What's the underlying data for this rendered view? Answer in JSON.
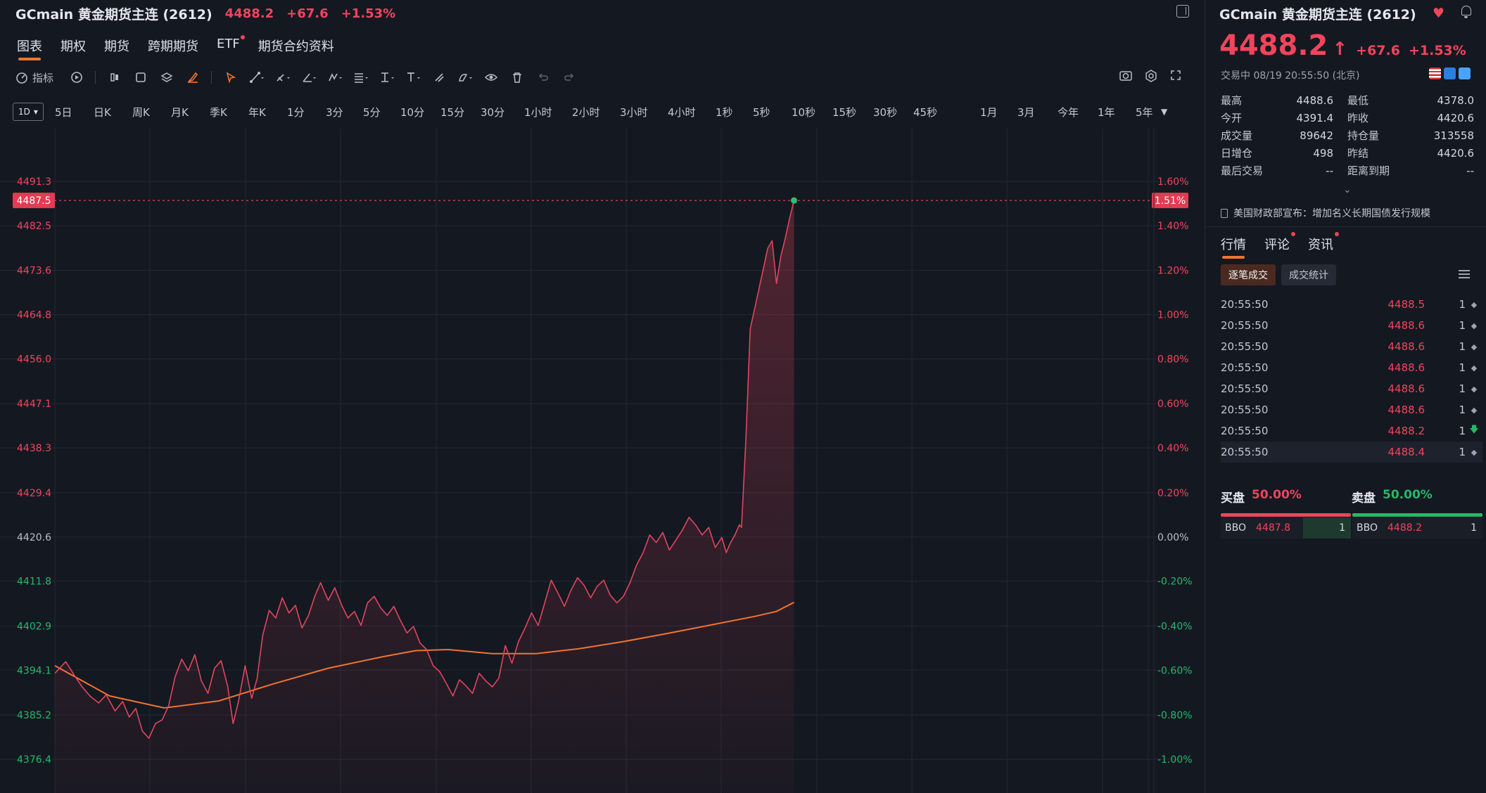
{
  "header": {
    "symbol": "GCmain",
    "name": "黄金期货主连 (2612)",
    "price": "4488.2",
    "change": "+67.6",
    "change_pct": "+1.53%"
  },
  "nav": {
    "tabs": [
      "图表",
      "期权",
      "期货",
      "跨期期货",
      "ETF",
      "期货合约资料"
    ],
    "active": "图表"
  },
  "toolbar": {
    "indicator_label": "指标",
    "icons": [
      "indicator-icon",
      "replay-icon",
      "candle-icon",
      "rect-icon",
      "layers-icon",
      "brush-icon",
      "cursor-icon",
      "trendline-icon",
      "pen-icon",
      "angle-icon",
      "pattern-icon",
      "fib-icon",
      "measure-icon",
      "text-icon",
      "magnet-icon",
      "shape-icon",
      "eye-icon",
      "trash-icon",
      "undo-icon",
      "redo-icon"
    ],
    "right_icons": [
      "camera-icon",
      "gear-icon",
      "fullscreen-icon"
    ]
  },
  "periods": {
    "selected": "1D",
    "items": [
      "5日",
      "日K",
      "周K",
      "月K",
      "季K",
      "年K",
      "1分",
      "3分",
      "5分",
      "10分",
      "15分",
      "30分",
      "1小时",
      "2小时",
      "3小时",
      "4小时",
      "1秒",
      "5秒",
      "10秒",
      "15秒",
      "30秒",
      "45秒",
      "1月",
      "3月",
      "今年",
      "1年",
      "5年"
    ]
  },
  "colors": {
    "up": "#f0455c",
    "down": "#25b86a",
    "accent": "#f0742e",
    "avg_line": "#f0742e",
    "background": "#141821"
  },
  "chart_data": {
    "type": "line",
    "prev_close": 4420.6,
    "y_ticks": [
      "4491.3",
      "4482.5",
      "4473.6",
      "4464.8",
      "4456.0",
      "4447.1",
      "4438.3",
      "4429.4",
      "4420.6",
      "4411.8",
      "4402.9",
      "4394.1",
      "4385.2",
      "4376.4"
    ],
    "y_tick_values": [
      4491.3,
      4482.5,
      4473.6,
      4464.8,
      4456.0,
      4447.1,
      4438.3,
      4429.4,
      4420.6,
      4411.8,
      4402.9,
      4394.1,
      4385.2,
      4376.4
    ],
    "pct_ticks": [
      "1.60%",
      "1.40%",
      "1.20%",
      "1.00%",
      "0.80%",
      "0.60%",
      "0.40%",
      "0.20%",
      "0.00%",
      "-0.20%",
      "-0.40%",
      "-0.60%",
      "-0.80%",
      "-1.00%"
    ],
    "current_price_label": "4487.5",
    "current_pct_label": "1.51%",
    "current_value": 4487.5,
    "ylim": [
      4374.5,
      4495.0
    ],
    "session_fraction": 0.628,
    "price_series": [
      [
        0.0,
        4393.5
      ],
      [
        0.01,
        4395.8
      ],
      [
        0.018,
        4393.0
      ],
      [
        0.025,
        4390.8
      ],
      [
        0.032,
        4389.0
      ],
      [
        0.04,
        4387.6
      ],
      [
        0.047,
        4389.2
      ],
      [
        0.055,
        4386.0
      ],
      [
        0.062,
        4387.9
      ],
      [
        0.068,
        4384.8
      ],
      [
        0.074,
        4386.5
      ],
      [
        0.08,
        4382.0
      ],
      [
        0.086,
        4380.6
      ],
      [
        0.092,
        4383.5
      ],
      [
        0.098,
        4384.2
      ],
      [
        0.104,
        4387.0
      ],
      [
        0.11,
        4392.8
      ],
      [
        0.116,
        4396.3
      ],
      [
        0.122,
        4394.0
      ],
      [
        0.128,
        4397.2
      ],
      [
        0.134,
        4392.0
      ],
      [
        0.14,
        4389.5
      ],
      [
        0.146,
        4394.5
      ],
      [
        0.152,
        4396.0
      ],
      [
        0.158,
        4391.0
      ],
      [
        0.163,
        4383.5
      ],
      [
        0.168,
        4388.0
      ],
      [
        0.174,
        4395.0
      ],
      [
        0.18,
        4388.5
      ],
      [
        0.185,
        4392.5
      ],
      [
        0.19,
        4401.0
      ],
      [
        0.196,
        4406.0
      ],
      [
        0.202,
        4404.5
      ],
      [
        0.208,
        4408.5
      ],
      [
        0.214,
        4405.5
      ],
      [
        0.22,
        4407.0
      ],
      [
        0.226,
        4402.5
      ],
      [
        0.232,
        4405.0
      ],
      [
        0.238,
        4409.0
      ],
      [
        0.243,
        4411.5
      ],
      [
        0.25,
        4408.0
      ],
      [
        0.256,
        4410.5
      ],
      [
        0.262,
        4407.2
      ],
      [
        0.268,
        4404.5
      ],
      [
        0.274,
        4405.8
      ],
      [
        0.28,
        4403.0
      ],
      [
        0.286,
        4407.5
      ],
      [
        0.292,
        4408.8
      ],
      [
        0.298,
        4406.5
      ],
      [
        0.304,
        4405.0
      ],
      [
        0.31,
        4406.8
      ],
      [
        0.316,
        4404.0
      ],
      [
        0.322,
        4401.5
      ],
      [
        0.328,
        4402.8
      ],
      [
        0.334,
        4399.5
      ],
      [
        0.34,
        4398.2
      ],
      [
        0.346,
        4395.0
      ],
      [
        0.352,
        4393.8
      ],
      [
        0.358,
        4391.5
      ],
      [
        0.364,
        4389.0
      ],
      [
        0.37,
        4392.2
      ],
      [
        0.376,
        4391.0
      ],
      [
        0.382,
        4389.5
      ],
      [
        0.388,
        4393.5
      ],
      [
        0.394,
        4392.0
      ],
      [
        0.4,
        4390.8
      ],
      [
        0.406,
        4392.5
      ],
      [
        0.412,
        4399.0
      ],
      [
        0.418,
        4395.5
      ],
      [
        0.424,
        4399.8
      ],
      [
        0.43,
        4402.5
      ],
      [
        0.436,
        4405.5
      ],
      [
        0.442,
        4403.0
      ],
      [
        0.448,
        4407.5
      ],
      [
        0.454,
        4412.0
      ],
      [
        0.46,
        4409.5
      ],
      [
        0.466,
        4406.8
      ],
      [
        0.472,
        4410.0
      ],
      [
        0.478,
        4412.5
      ],
      [
        0.484,
        4411.0
      ],
      [
        0.49,
        4408.5
      ],
      [
        0.496,
        4410.8
      ],
      [
        0.502,
        4412.0
      ],
      [
        0.508,
        4409.0
      ],
      [
        0.514,
        4407.5
      ],
      [
        0.52,
        4408.8
      ],
      [
        0.526,
        4411.5
      ],
      [
        0.532,
        4415.0
      ],
      [
        0.538,
        4417.5
      ],
      [
        0.544,
        4421.0
      ],
      [
        0.55,
        4419.5
      ],
      [
        0.556,
        4421.5
      ],
      [
        0.562,
        4418.0
      ],
      [
        0.568,
        4420.0
      ],
      [
        0.574,
        4422.0
      ],
      [
        0.58,
        4424.5
      ],
      [
        0.586,
        4423.0
      ],
      [
        0.592,
        4421.0
      ],
      [
        0.598,
        4422.5
      ],
      [
        0.604,
        4418.5
      ],
      [
        0.61,
        4420.5
      ],
      [
        0.614,
        4417.5
      ],
      [
        0.618,
        4419.5
      ],
      [
        0.622,
        4421.0
      ],
      [
        0.626,
        4423.0
      ],
      [
        0.628,
        4422.5
      ],
      [
        0.632,
        4440.0
      ],
      [
        0.636,
        4462.0
      ],
      [
        0.64,
        4466.0
      ],
      [
        0.644,
        4470.0
      ],
      [
        0.648,
        4474.0
      ],
      [
        0.652,
        4478.0
      ],
      [
        0.656,
        4479.5
      ],
      [
        0.66,
        4471.0
      ],
      [
        0.664,
        4476.5
      ],
      [
        0.668,
        4480.0
      ],
      [
        0.672,
        4484.0
      ],
      [
        0.676,
        4487.5
      ]
    ],
    "avg_series": [
      [
        0.0,
        4395.0
      ],
      [
        0.05,
        4389.0
      ],
      [
        0.1,
        4386.6
      ],
      [
        0.15,
        4388.0
      ],
      [
        0.2,
        4391.4
      ],
      [
        0.25,
        4394.5
      ],
      [
        0.3,
        4396.8
      ],
      [
        0.33,
        4398.0
      ],
      [
        0.36,
        4398.2
      ],
      [
        0.4,
        4397.4
      ],
      [
        0.44,
        4397.4
      ],
      [
        0.48,
        4398.4
      ],
      [
        0.52,
        4399.8
      ],
      [
        0.56,
        4401.4
      ],
      [
        0.6,
        4403.1
      ],
      [
        0.64,
        4404.8
      ],
      [
        0.66,
        4405.8
      ],
      [
        0.676,
        4407.6
      ]
    ]
  },
  "quote": {
    "symbol": "GCmain",
    "name": "黄金期货主连 (2612)",
    "price": "4488.2",
    "arrow": "↑",
    "change": "+67.6",
    "change_pct": "+1.53%",
    "status": "交易中 08/19 20:55:50 (北京)",
    "stats": [
      {
        "k": "最高",
        "v": "4488.6",
        "vc": "red",
        "k2": "最低",
        "v2": "4378.0",
        "v2c": "green"
      },
      {
        "k": "今开",
        "v": "4391.4",
        "vc": "green",
        "k2": "昨收",
        "v2": "4420.6",
        "v2c": ""
      },
      {
        "k": "成交量",
        "v": "89642",
        "vc": "",
        "k2": "持仓量",
        "v2": "313558",
        "v2c": ""
      },
      {
        "k": "日增仓",
        "v": "498",
        "vc": "",
        "k2": "昨结",
        "v2": "4420.6",
        "v2c": ""
      },
      {
        "k": "最后交易",
        "v": "--",
        "vc": "",
        "k2": "距离到期",
        "v2": "--",
        "v2c": ""
      }
    ],
    "news": "美国财政部宣布：增加名义长期国债发行规模"
  },
  "detail_tabs": {
    "tabs": [
      "行情",
      "评论",
      "资讯"
    ],
    "active": "行情",
    "subtabs": [
      "逐笔成交",
      "成交统计"
    ],
    "active_sub": "逐笔成交"
  },
  "trades": [
    {
      "time": "20:55:50",
      "price": "4488.5",
      "qty": "1",
      "dir": "flat"
    },
    {
      "time": "20:55:50",
      "price": "4488.6",
      "qty": "1",
      "dir": "flat"
    },
    {
      "time": "20:55:50",
      "price": "4488.6",
      "qty": "1",
      "dir": "flat"
    },
    {
      "time": "20:55:50",
      "price": "4488.6",
      "qty": "1",
      "dir": "flat"
    },
    {
      "time": "20:55:50",
      "price": "4488.6",
      "qty": "1",
      "dir": "flat"
    },
    {
      "time": "20:55:50",
      "price": "4488.6",
      "qty": "1",
      "dir": "flat"
    },
    {
      "time": "20:55:50",
      "price": "4488.2",
      "qty": "1",
      "dir": "down"
    },
    {
      "time": "20:55:50",
      "price": "4488.4",
      "qty": "1",
      "dir": "flat"
    }
  ],
  "orderbook": {
    "bid_label": "买盘",
    "bid_pct": "50.00%",
    "ask_label": "卖盘",
    "ask_pct": "50.00%",
    "bid_fraction": 0.5,
    "bid": {
      "label": "BBO",
      "price": "4487.8",
      "qty": "1"
    },
    "ask": {
      "label": "BBO",
      "price": "4488.2",
      "qty": "1"
    }
  }
}
